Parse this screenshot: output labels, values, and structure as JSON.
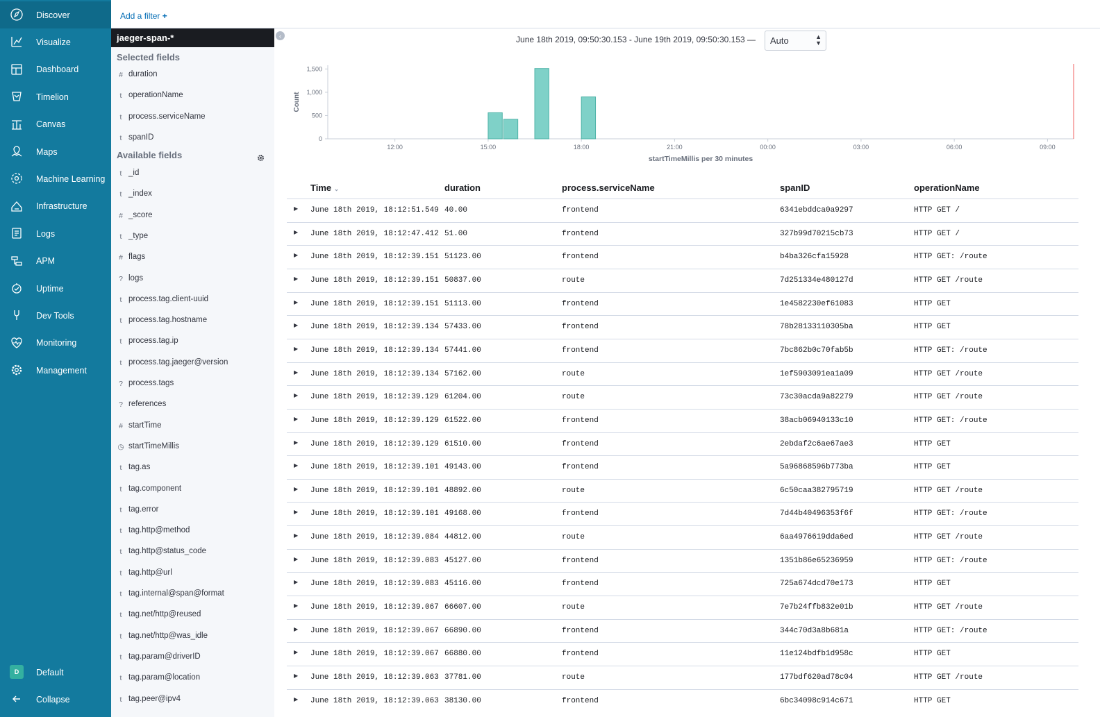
{
  "nav": {
    "items": [
      {
        "label": "Discover",
        "icon": "compass-icon",
        "active": true
      },
      {
        "label": "Visualize",
        "icon": "visualize-icon"
      },
      {
        "label": "Dashboard",
        "icon": "dashboard-icon"
      },
      {
        "label": "Timelion",
        "icon": "timelion-icon"
      },
      {
        "label": "Canvas",
        "icon": "canvas-icon"
      },
      {
        "label": "Maps",
        "icon": "maps-icon"
      },
      {
        "label": "Machine Learning",
        "icon": "machine-learning-icon"
      },
      {
        "label": "Infrastructure",
        "icon": "infrastructure-icon"
      },
      {
        "label": "Logs",
        "icon": "logs-icon"
      },
      {
        "label": "APM",
        "icon": "apm-icon"
      },
      {
        "label": "Uptime",
        "icon": "uptime-icon"
      },
      {
        "label": "Dev Tools",
        "icon": "dev-tools-icon"
      },
      {
        "label": "Monitoring",
        "icon": "monitoring-icon"
      },
      {
        "label": "Management",
        "icon": "gear-icon"
      }
    ],
    "space": {
      "label": "Default",
      "badge": "D"
    },
    "collapse": {
      "label": "Collapse",
      "icon": "arrow-left-icon"
    }
  },
  "filter": {
    "add_label": "Add a filter",
    "plus": "+"
  },
  "sidebar": {
    "index_pattern": "jaeger-span-*",
    "selected_title": "Selected fields",
    "selected": [
      {
        "type": "#",
        "name": "duration"
      },
      {
        "type": "t",
        "name": "operationName"
      },
      {
        "type": "t",
        "name": "process.serviceName"
      },
      {
        "type": "t",
        "name": "spanID"
      }
    ],
    "available_title": "Available fields",
    "available": [
      {
        "type": "t",
        "name": "_id"
      },
      {
        "type": "t",
        "name": "_index"
      },
      {
        "type": "#",
        "name": "_score"
      },
      {
        "type": "t",
        "name": "_type"
      },
      {
        "type": "#",
        "name": "flags"
      },
      {
        "type": "?",
        "name": "logs"
      },
      {
        "type": "t",
        "name": "process.tag.client-uuid"
      },
      {
        "type": "t",
        "name": "process.tag.hostname"
      },
      {
        "type": "t",
        "name": "process.tag.ip"
      },
      {
        "type": "t",
        "name": "process.tag.jaeger@version"
      },
      {
        "type": "?",
        "name": "process.tags"
      },
      {
        "type": "?",
        "name": "references"
      },
      {
        "type": "#",
        "name": "startTime"
      },
      {
        "type": "◷",
        "name": "startTimeMillis"
      },
      {
        "type": "t",
        "name": "tag.as"
      },
      {
        "type": "t",
        "name": "tag.component"
      },
      {
        "type": "t",
        "name": "tag.error"
      },
      {
        "type": "t",
        "name": "tag.http@method"
      },
      {
        "type": "t",
        "name": "tag.http@status_code"
      },
      {
        "type": "t",
        "name": "tag.http@url"
      },
      {
        "type": "t",
        "name": "tag.internal@span@format"
      },
      {
        "type": "t",
        "name": "tag.net/http@reused"
      },
      {
        "type": "t",
        "name": "tag.net/http@was_idle"
      },
      {
        "type": "t",
        "name": "tag.param@driverID"
      },
      {
        "type": "t",
        "name": "tag.param@location"
      },
      {
        "type": "t",
        "name": "tag.peer@ipv4"
      }
    ]
  },
  "time_range": "June 18th 2019, 09:50:30.153 - June 19th 2019, 09:50:30.153 —",
  "interval": {
    "value": "Auto"
  },
  "chart_data": {
    "type": "bar",
    "ylabel": "Count",
    "xlabel": "startTimeMillis per 30 minutes",
    "x_ticks": [
      "12:00",
      "15:00",
      "18:00",
      "21:00",
      "00:00",
      "03:00",
      "06:00",
      "09:00"
    ],
    "y_ticks": [
      "0",
      "500",
      "1,000",
      "1,500"
    ],
    "ylim": [
      0,
      1580
    ],
    "x_start_hour": 9.84,
    "x_span_hours": 24,
    "color": "#7fd1c8",
    "bars": [
      {
        "hour": 15.0,
        "value": 560
      },
      {
        "hour": 15.5,
        "value": 420
      },
      {
        "hour": 16.5,
        "value": 1510
      },
      {
        "hour": 18.0,
        "value": 900
      }
    ]
  },
  "table": {
    "columns": [
      "Time",
      "duration",
      "process.serviceName",
      "spanID",
      "operationName"
    ],
    "sort_icon": "⌄",
    "rows": [
      [
        "June 18th 2019, 18:12:51.549",
        "40.00",
        "frontend",
        "6341ebddca0a9297",
        "HTTP GET /"
      ],
      [
        "June 18th 2019, 18:12:47.412",
        "51.00",
        "frontend",
        "327b99d70215cb73",
        "HTTP GET /"
      ],
      [
        "June 18th 2019, 18:12:39.151",
        "51123.00",
        "frontend",
        "b4ba326cfa15928",
        "HTTP GET: /route"
      ],
      [
        "June 18th 2019, 18:12:39.151",
        "50837.00",
        "route",
        "7d251334e480127d",
        "HTTP GET /route"
      ],
      [
        "June 18th 2019, 18:12:39.151",
        "51113.00",
        "frontend",
        "1e4582230ef61083",
        "HTTP GET"
      ],
      [
        "June 18th 2019, 18:12:39.134",
        "57433.00",
        "frontend",
        "78b28133110305ba",
        "HTTP GET"
      ],
      [
        "June 18th 2019, 18:12:39.134",
        "57441.00",
        "frontend",
        "7bc862b0c70fab5b",
        "HTTP GET: /route"
      ],
      [
        "June 18th 2019, 18:12:39.134",
        "57162.00",
        "route",
        "1ef5903091ea1a09",
        "HTTP GET /route"
      ],
      [
        "June 18th 2019, 18:12:39.129",
        "61204.00",
        "route",
        "73c30acda9a82279",
        "HTTP GET /route"
      ],
      [
        "June 18th 2019, 18:12:39.129",
        "61522.00",
        "frontend",
        "38acb06940133c10",
        "HTTP GET: /route"
      ],
      [
        "June 18th 2019, 18:12:39.129",
        "61510.00",
        "frontend",
        "2ebdaf2c6ae67ae3",
        "HTTP GET"
      ],
      [
        "June 18th 2019, 18:12:39.101",
        "49143.00",
        "frontend",
        "5a96868596b773ba",
        "HTTP GET"
      ],
      [
        "June 18th 2019, 18:12:39.101",
        "48892.00",
        "route",
        "6c50caa382795719",
        "HTTP GET /route"
      ],
      [
        "June 18th 2019, 18:12:39.101",
        "49168.00",
        "frontend",
        "7d44b40496353f6f",
        "HTTP GET: /route"
      ],
      [
        "June 18th 2019, 18:12:39.084",
        "44812.00",
        "route",
        "6aa4976619dda6ed",
        "HTTP GET /route"
      ],
      [
        "June 18th 2019, 18:12:39.083",
        "45127.00",
        "frontend",
        "1351b86e65236959",
        "HTTP GET: /route"
      ],
      [
        "June 18th 2019, 18:12:39.083",
        "45116.00",
        "frontend",
        "725a674dcd70e173",
        "HTTP GET"
      ],
      [
        "June 18th 2019, 18:12:39.067",
        "66607.00",
        "route",
        "7e7b24ffb832e01b",
        "HTTP GET /route"
      ],
      [
        "June 18th 2019, 18:12:39.067",
        "66890.00",
        "frontend",
        "344c70d3a8b681a",
        "HTTP GET: /route"
      ],
      [
        "June 18th 2019, 18:12:39.067",
        "66880.00",
        "frontend",
        "11e124bdfb1d958c",
        "HTTP GET"
      ],
      [
        "June 18th 2019, 18:12:39.063",
        "37781.00",
        "route",
        "177bdf620ad78c04",
        "HTTP GET /route"
      ],
      [
        "June 18th 2019, 18:12:39.063",
        "38130.00",
        "frontend",
        "6bc34098c914c671",
        "HTTP GET"
      ]
    ]
  }
}
